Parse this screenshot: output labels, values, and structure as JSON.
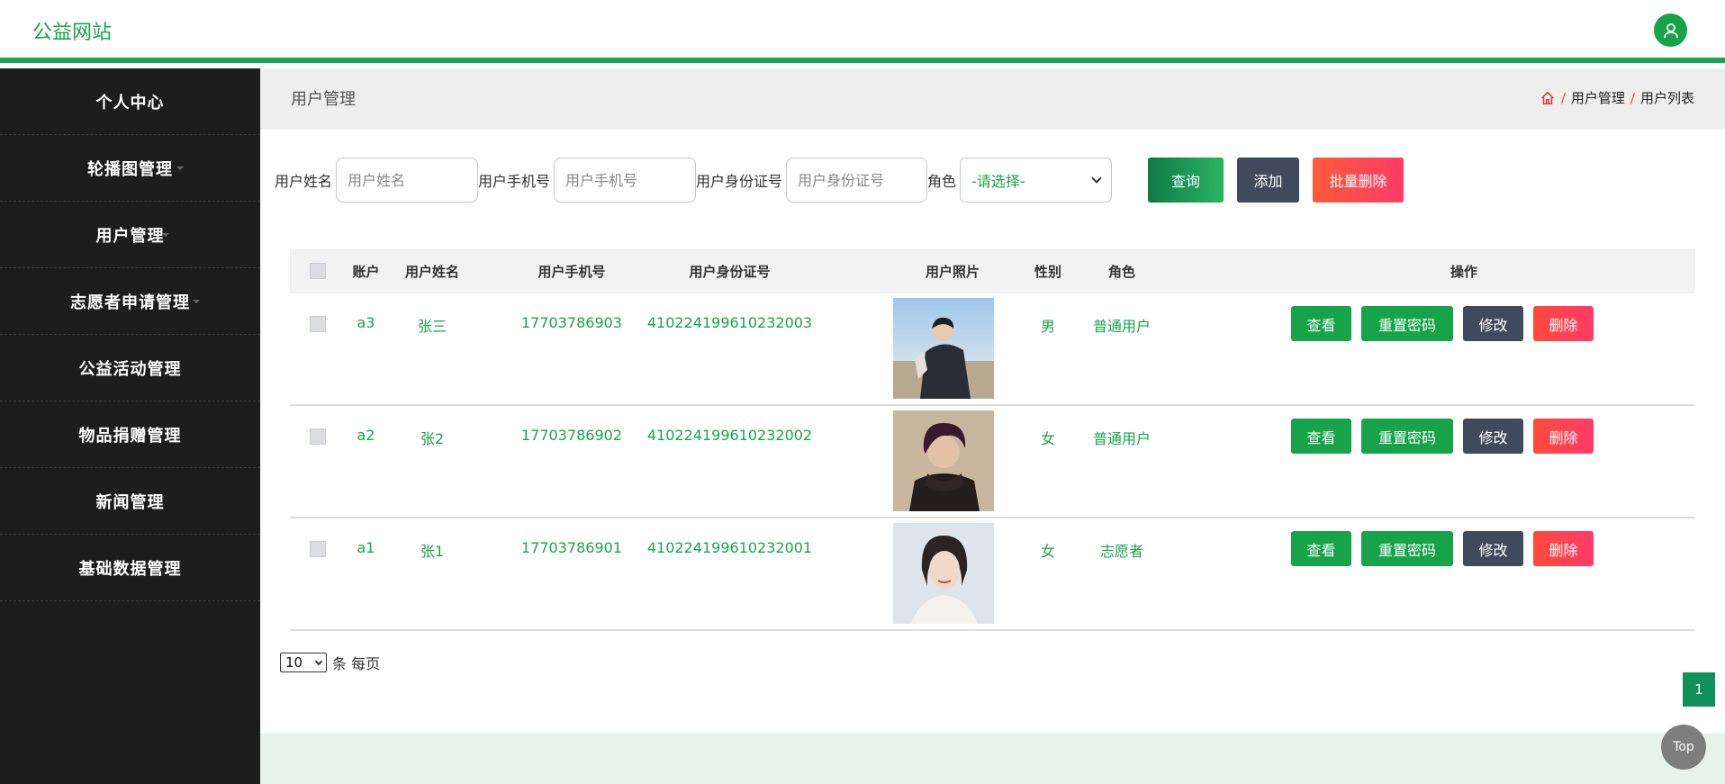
{
  "header": {
    "brand": "公益网站",
    "user_icon": "user-icon"
  },
  "sidebar": {
    "items": [
      {
        "label": "个人中心",
        "caret": false
      },
      {
        "label": "轮播图管理",
        "caret": true
      },
      {
        "label": "用户管理",
        "caret": true
      },
      {
        "label": "志愿者申请管理",
        "caret": true
      },
      {
        "label": "公益活动管理",
        "caret": false
      },
      {
        "label": "物品捐赠管理",
        "caret": false
      },
      {
        "label": "新闻管理",
        "caret": false
      },
      {
        "label": "基础数据管理",
        "caret": false
      }
    ]
  },
  "page": {
    "title": "用户管理",
    "breadcrumb": [
      "用户管理",
      "用户列表"
    ]
  },
  "search": {
    "name_label": "用户姓名",
    "name_placeholder": "用户姓名",
    "phone_label": "用户手机号",
    "phone_placeholder": "用户手机号",
    "id_label": "用户身份证号",
    "id_placeholder": "用户身份证号",
    "role_label": "角色",
    "role_selected": "-请选择-",
    "btn_search": "查询",
    "btn_add": "添加",
    "btn_batch_delete": "批量删除"
  },
  "table": {
    "headers": [
      "账户",
      "用户姓名",
      "用户手机号",
      "用户身份证号",
      "用户照片",
      "性别",
      "角色",
      "操作"
    ],
    "rows": [
      {
        "account": "a3",
        "name": "张三",
        "phone": "17703786903",
        "id_number": "410224199610232003",
        "gender": "男",
        "role": "普通用户"
      },
      {
        "account": "a2",
        "name": "张2",
        "phone": "17703786902",
        "id_number": "410224199610232002",
        "gender": "女",
        "role": "普通用户"
      },
      {
        "account": "a1",
        "name": "张1",
        "phone": "17703786901",
        "id_number": "410224199610232001",
        "gender": "女",
        "role": "志愿者"
      }
    ],
    "actions": {
      "view": "查看",
      "reset": "重置密码",
      "edit": "修改",
      "delete": "删除"
    }
  },
  "pager": {
    "page_size": "10",
    "per_page_label": "条 每页",
    "current_page": "1"
  },
  "top_button": "Top",
  "colors": {
    "accent": "#1aa34a",
    "sidebar": "#1d1d1d",
    "danger": "#ff4a4a",
    "dark_button": "#414a5a"
  }
}
